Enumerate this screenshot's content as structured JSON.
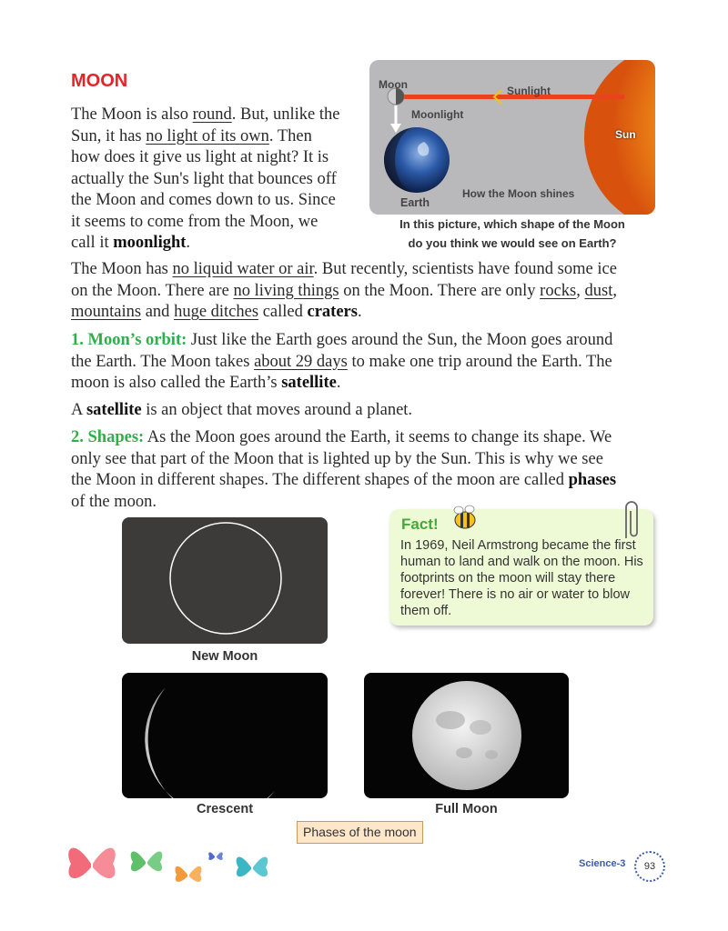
{
  "heading": "MOON",
  "intro": {
    "l1a": "The Moon is also ",
    "l1u": "round",
    "l1b": ". But, unlike the",
    "l2a": "Sun, it has ",
    "l2u": "no light of its own",
    "l2b": ". Then",
    "l3": "how does it give us light at night? It is",
    "l4": "actually the Sun's light that bounces off",
    "l5": "the Moon and comes down to us. Since",
    "l6": "it seems to come from the Moon, we",
    "l7a": "call it ",
    "l7b": "moonlight",
    "l7c": "."
  },
  "diagram": {
    "moon": "Moon",
    "sunlight": "Sunlight",
    "moonlight": "Moonlight",
    "sun": "Sun",
    "earth": "Earth",
    "caption_inner": "How the Moon shines",
    "question_l1": "In this picture, which shape of the Moon",
    "question_l2": "do you think we would see on Earth?"
  },
  "para2": {
    "a": "The Moon has ",
    "u1": "no liquid water or air",
    "b": ". But recently, scientists have found some ice",
    "c": "on the Moon. There are ",
    "u2": "no living things",
    "d": " on the Moon. There are only ",
    "u3": "rocks",
    "e": ", ",
    "u4": "dust",
    "f": ",",
    "u5": "mountains",
    "g": " and ",
    "u6": "huge ditches",
    "h": " called ",
    "bold": "craters",
    "i": "."
  },
  "orbit": {
    "label": "1. Moon’s orbit:",
    "l1": " Just like the Earth goes around the Sun, the Moon goes around",
    "l2a": "the Earth. The Moon takes ",
    "l2u": "about 29 days",
    "l2b": " to make one trip around the Earth. The",
    "l3a": "moon is also called the Earth’s ",
    "l3b": "satellite",
    "l3c": "."
  },
  "satellite": {
    "a": "A ",
    "b": "satellite",
    "c": " is an object that moves around a planet."
  },
  "shapes": {
    "label": "2. Shapes:",
    "l1": " As the Moon goes around the Earth, it seems to change its shape. We",
    "l2": "only see that part of the Moon that is lighted up by the Sun. This is why we see",
    "l3a": "the Moon in different shapes. The different shapes of the moon are called ",
    "l3b": "phases",
    "l4": "of the moon."
  },
  "fact": {
    "title": "Fact!",
    "text": "In 1969, Neil Armstrong became the first human to land and walk on the moon. His footprints on the moon will stay there forever! There is no air or water to blow them off."
  },
  "phases": {
    "new": "New Moon",
    "crescent": "Crescent",
    "full": "Full Moon",
    "tag": "Phases of the moon"
  },
  "footer": {
    "book": "Science-3",
    "page": "93"
  }
}
